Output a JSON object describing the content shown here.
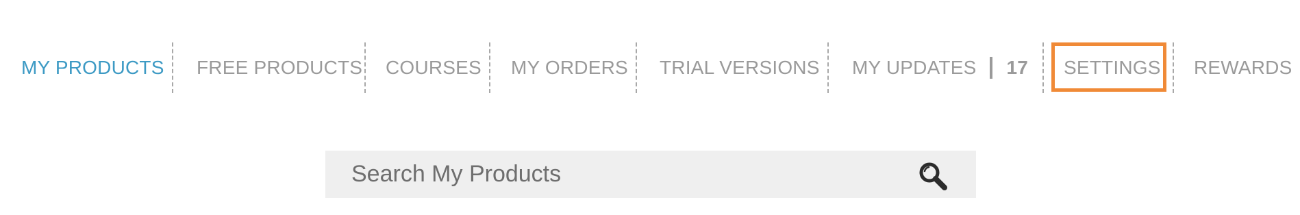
{
  "nav": {
    "tabs": [
      {
        "label": "MY PRODUCTS",
        "active": true
      },
      {
        "label": "FREE PRODUCTS",
        "active": false
      },
      {
        "label": "COURSES",
        "active": false
      },
      {
        "label": "MY ORDERS",
        "active": false
      },
      {
        "label": "TRIAL VERSIONS",
        "active": false
      },
      {
        "label": "MY UPDATES",
        "active": false,
        "count": "17"
      },
      {
        "label": "SETTINGS",
        "active": false,
        "highlighted": true
      },
      {
        "label": "REWARDS",
        "active": false
      }
    ]
  },
  "search": {
    "placeholder": "Search My Products",
    "icon": "search-icon"
  },
  "colors": {
    "active_tab": "#3d9ac4",
    "inactive_tab": "#9a9a9a",
    "highlight": "#f08a37",
    "search_bg": "#efefef"
  }
}
